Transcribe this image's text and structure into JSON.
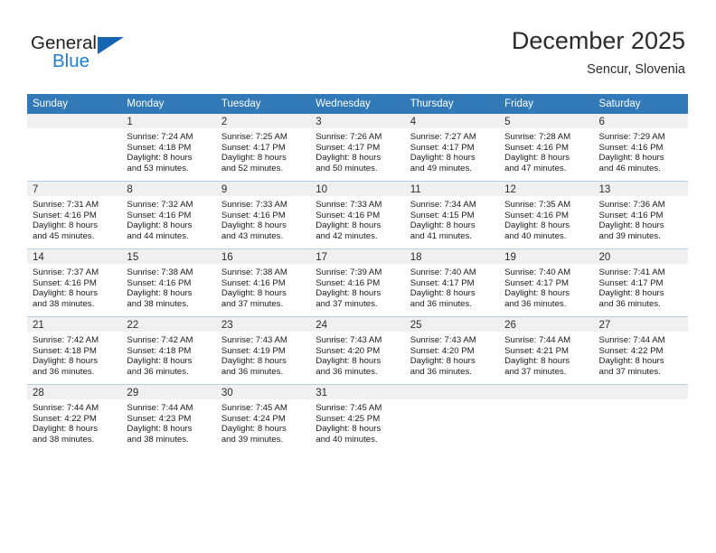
{
  "brand": {
    "name_part1": "General",
    "name_part2": "Blue"
  },
  "header": {
    "month_title": "December 2025",
    "location": "Sencur, Slovenia"
  },
  "calendar": {
    "weekday_headers": [
      "Sunday",
      "Monday",
      "Tuesday",
      "Wednesday",
      "Thursday",
      "Friday",
      "Saturday"
    ],
    "colors": {
      "header_blue": "#3279b8",
      "daynum_band": "#f0f0f0",
      "row_border": "#b8cde0",
      "brand_blue": "#1b7fd4",
      "logo_mark_blue": "#1565b0"
    },
    "weeks": [
      [
        {
          "day": "",
          "lines": []
        },
        {
          "day": "1",
          "lines": [
            "Sunrise: 7:24 AM",
            "Sunset: 4:18 PM",
            "Daylight: 8 hours",
            "and 53 minutes."
          ]
        },
        {
          "day": "2",
          "lines": [
            "Sunrise: 7:25 AM",
            "Sunset: 4:17 PM",
            "Daylight: 8 hours",
            "and 52 minutes."
          ]
        },
        {
          "day": "3",
          "lines": [
            "Sunrise: 7:26 AM",
            "Sunset: 4:17 PM",
            "Daylight: 8 hours",
            "and 50 minutes."
          ]
        },
        {
          "day": "4",
          "lines": [
            "Sunrise: 7:27 AM",
            "Sunset: 4:17 PM",
            "Daylight: 8 hours",
            "and 49 minutes."
          ]
        },
        {
          "day": "5",
          "lines": [
            "Sunrise: 7:28 AM",
            "Sunset: 4:16 PM",
            "Daylight: 8 hours",
            "and 47 minutes."
          ]
        },
        {
          "day": "6",
          "lines": [
            "Sunrise: 7:29 AM",
            "Sunset: 4:16 PM",
            "Daylight: 8 hours",
            "and 46 minutes."
          ]
        }
      ],
      [
        {
          "day": "7",
          "lines": [
            "Sunrise: 7:31 AM",
            "Sunset: 4:16 PM",
            "Daylight: 8 hours",
            "and 45 minutes."
          ]
        },
        {
          "day": "8",
          "lines": [
            "Sunrise: 7:32 AM",
            "Sunset: 4:16 PM",
            "Daylight: 8 hours",
            "and 44 minutes."
          ]
        },
        {
          "day": "9",
          "lines": [
            "Sunrise: 7:33 AM",
            "Sunset: 4:16 PM",
            "Daylight: 8 hours",
            "and 43 minutes."
          ]
        },
        {
          "day": "10",
          "lines": [
            "Sunrise: 7:33 AM",
            "Sunset: 4:16 PM",
            "Daylight: 8 hours",
            "and 42 minutes."
          ]
        },
        {
          "day": "11",
          "lines": [
            "Sunrise: 7:34 AM",
            "Sunset: 4:15 PM",
            "Daylight: 8 hours",
            "and 41 minutes."
          ]
        },
        {
          "day": "12",
          "lines": [
            "Sunrise: 7:35 AM",
            "Sunset: 4:16 PM",
            "Daylight: 8 hours",
            "and 40 minutes."
          ]
        },
        {
          "day": "13",
          "lines": [
            "Sunrise: 7:36 AM",
            "Sunset: 4:16 PM",
            "Daylight: 8 hours",
            "and 39 minutes."
          ]
        }
      ],
      [
        {
          "day": "14",
          "lines": [
            "Sunrise: 7:37 AM",
            "Sunset: 4:16 PM",
            "Daylight: 8 hours",
            "and 38 minutes."
          ]
        },
        {
          "day": "15",
          "lines": [
            "Sunrise: 7:38 AM",
            "Sunset: 4:16 PM",
            "Daylight: 8 hours",
            "and 38 minutes."
          ]
        },
        {
          "day": "16",
          "lines": [
            "Sunrise: 7:38 AM",
            "Sunset: 4:16 PM",
            "Daylight: 8 hours",
            "and 37 minutes."
          ]
        },
        {
          "day": "17",
          "lines": [
            "Sunrise: 7:39 AM",
            "Sunset: 4:16 PM",
            "Daylight: 8 hours",
            "and 37 minutes."
          ]
        },
        {
          "day": "18",
          "lines": [
            "Sunrise: 7:40 AM",
            "Sunset: 4:17 PM",
            "Daylight: 8 hours",
            "and 36 minutes."
          ]
        },
        {
          "day": "19",
          "lines": [
            "Sunrise: 7:40 AM",
            "Sunset: 4:17 PM",
            "Daylight: 8 hours",
            "and 36 minutes."
          ]
        },
        {
          "day": "20",
          "lines": [
            "Sunrise: 7:41 AM",
            "Sunset: 4:17 PM",
            "Daylight: 8 hours",
            "and 36 minutes."
          ]
        }
      ],
      [
        {
          "day": "21",
          "lines": [
            "Sunrise: 7:42 AM",
            "Sunset: 4:18 PM",
            "Daylight: 8 hours",
            "and 36 minutes."
          ]
        },
        {
          "day": "22",
          "lines": [
            "Sunrise: 7:42 AM",
            "Sunset: 4:18 PM",
            "Daylight: 8 hours",
            "and 36 minutes."
          ]
        },
        {
          "day": "23",
          "lines": [
            "Sunrise: 7:43 AM",
            "Sunset: 4:19 PM",
            "Daylight: 8 hours",
            "and 36 minutes."
          ]
        },
        {
          "day": "24",
          "lines": [
            "Sunrise: 7:43 AM",
            "Sunset: 4:20 PM",
            "Daylight: 8 hours",
            "and 36 minutes."
          ]
        },
        {
          "day": "25",
          "lines": [
            "Sunrise: 7:43 AM",
            "Sunset: 4:20 PM",
            "Daylight: 8 hours",
            "and 36 minutes."
          ]
        },
        {
          "day": "26",
          "lines": [
            "Sunrise: 7:44 AM",
            "Sunset: 4:21 PM",
            "Daylight: 8 hours",
            "and 37 minutes."
          ]
        },
        {
          "day": "27",
          "lines": [
            "Sunrise: 7:44 AM",
            "Sunset: 4:22 PM",
            "Daylight: 8 hours",
            "and 37 minutes."
          ]
        }
      ],
      [
        {
          "day": "28",
          "lines": [
            "Sunrise: 7:44 AM",
            "Sunset: 4:22 PM",
            "Daylight: 8 hours",
            "and 38 minutes."
          ]
        },
        {
          "day": "29",
          "lines": [
            "Sunrise: 7:44 AM",
            "Sunset: 4:23 PM",
            "Daylight: 8 hours",
            "and 38 minutes."
          ]
        },
        {
          "day": "30",
          "lines": [
            "Sunrise: 7:45 AM",
            "Sunset: 4:24 PM",
            "Daylight: 8 hours",
            "and 39 minutes."
          ]
        },
        {
          "day": "31",
          "lines": [
            "Sunrise: 7:45 AM",
            "Sunset: 4:25 PM",
            "Daylight: 8 hours",
            "and 40 minutes."
          ]
        },
        {
          "day": "",
          "lines": []
        },
        {
          "day": "",
          "lines": []
        },
        {
          "day": "",
          "lines": []
        }
      ]
    ]
  }
}
